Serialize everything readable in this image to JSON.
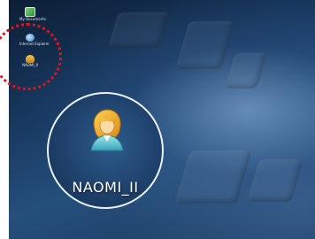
{
  "desktop": {
    "icons": [
      {
        "label": "My Documents"
      },
      {
        "label": "Internet Explorer"
      },
      {
        "label": "NAOMI_II"
      }
    ],
    "zoomed_icon": {
      "name": "user-icon",
      "label": "NAOMI_II"
    }
  }
}
